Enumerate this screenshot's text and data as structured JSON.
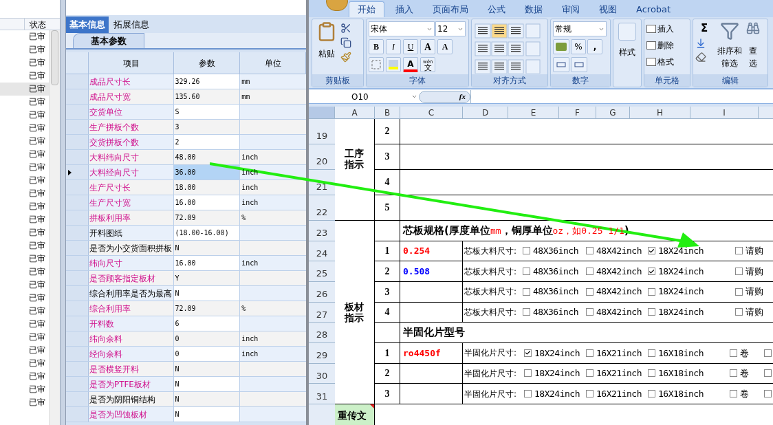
{
  "left_list": {
    "column_header": "状态",
    "rows": [
      {
        "status": "已审",
        "selected": false
      },
      {
        "status": "已审",
        "selected": false
      },
      {
        "status": "已审",
        "selected": false
      },
      {
        "status": "已审",
        "selected": false
      },
      {
        "status": "已审",
        "selected": true
      },
      {
        "status": "已审",
        "selected": false
      },
      {
        "status": "已审",
        "selected": false
      },
      {
        "status": "已审",
        "selected": false
      },
      {
        "status": "已审",
        "selected": false
      },
      {
        "status": "已审",
        "selected": false
      },
      {
        "status": "已审",
        "selected": false
      },
      {
        "status": "已审",
        "selected": false
      },
      {
        "status": "已审",
        "selected": false
      },
      {
        "status": "已审",
        "selected": false
      },
      {
        "status": "已审",
        "selected": false
      },
      {
        "status": "已审",
        "selected": false
      },
      {
        "status": "已审",
        "selected": false
      },
      {
        "status": "已审",
        "selected": false
      },
      {
        "status": "已审",
        "selected": false
      },
      {
        "status": "已审",
        "selected": false
      },
      {
        "status": "已审",
        "selected": false
      },
      {
        "status": "已审",
        "selected": false
      },
      {
        "status": "已审",
        "selected": false
      },
      {
        "status": "已审",
        "selected": false
      },
      {
        "status": "已审",
        "selected": false
      },
      {
        "status": "已审",
        "selected": false
      },
      {
        "status": "已审",
        "selected": false
      },
      {
        "status": "已审",
        "selected": false
      },
      {
        "status": "已审",
        "selected": false
      }
    ]
  },
  "detail_panel": {
    "tabs": [
      {
        "label": "基本信息",
        "selected": true
      },
      {
        "label": "拓展信息",
        "selected": false
      }
    ],
    "subtab": "基本参数",
    "columns": [
      "项目",
      "参数",
      "单位"
    ],
    "rows": [
      {
        "item": "成品尺寸长",
        "value": "329.26",
        "unit": "mm",
        "highlighted": true,
        "current": false
      },
      {
        "item": "成品尺寸宽",
        "value": "135.60",
        "unit": "mm",
        "highlighted": true,
        "current": false
      },
      {
        "item": "交货单位",
        "value": "S",
        "highlighted": true,
        "current": false
      },
      {
        "item": "生产拼板个数",
        "value": "3",
        "highlighted": true,
        "current": false
      },
      {
        "item": "交货拼板个数",
        "value": "2",
        "highlighted": true,
        "current": false
      },
      {
        "item": "大料纬向尺寸",
        "value": "48.00",
        "unit": "inch",
        "highlighted": true,
        "current": false
      },
      {
        "item": "大料经向尺寸",
        "value": "36.00",
        "unit": "inch",
        "highlighted": true,
        "current": true
      },
      {
        "item": "生产尺寸长",
        "value": "18.00",
        "unit": "inch",
        "highlighted": true,
        "current": false
      },
      {
        "item": "生产尺寸宽",
        "value": "16.00",
        "unit": "inch",
        "highlighted": true,
        "current": false
      },
      {
        "item": "拼板利用率",
        "value": "72.09",
        "unit": "%",
        "highlighted": true,
        "current": false
      },
      {
        "item": "开料图纸",
        "value": "(18.00-16.00)",
        "highlighted": false,
        "current": false
      },
      {
        "item": "是否为小交货面积拼板",
        "value": "N",
        "highlighted": false,
        "current": false
      },
      {
        "item": "纬向尺寸",
        "value": "16.00",
        "unit": "inch",
        "highlighted": true,
        "current": false
      },
      {
        "item": "是否顾客指定板材",
        "value": "Y",
        "highlighted": true,
        "current": false
      },
      {
        "item": "综合利用率是否为最高",
        "value": "N",
        "highlighted": false,
        "current": false
      },
      {
        "item": "综合利用率",
        "value": "72.09",
        "unit": "%",
        "highlighted": true,
        "current": false
      },
      {
        "item": "开料数",
        "value": "6",
        "highlighted": true,
        "current": false
      },
      {
        "item": "纬向余料",
        "value": "0",
        "unit": "inch",
        "highlighted": true,
        "current": false
      },
      {
        "item": "经向余料",
        "value": "0",
        "unit": "inch",
        "highlighted": true,
        "current": false
      },
      {
        "item": "是否横竖开料",
        "value": "N",
        "highlighted": true,
        "current": false
      },
      {
        "item": "是否为PTFE板材",
        "value": "N",
        "highlighted": true,
        "current": false
      },
      {
        "item": "是否为阴阳铜结构",
        "value": "N",
        "highlighted": false,
        "current": false
      },
      {
        "item": "是否为凹蚀板材",
        "value": "N",
        "highlighted": true,
        "current": false
      }
    ]
  },
  "excel": {
    "ribbon_tabs": [
      {
        "label": "开始",
        "selected": true
      },
      {
        "label": "插入",
        "selected": false
      },
      {
        "label": "页面布局",
        "selected": false
      },
      {
        "label": "公式",
        "selected": false
      },
      {
        "label": "数据",
        "selected": false
      },
      {
        "label": "审阅",
        "selected": false
      },
      {
        "label": "视图",
        "selected": false
      },
      {
        "label": "Acrobat",
        "selected": false
      }
    ],
    "clipboard": {
      "label": "剪贴板",
      "paste": "粘贴"
    },
    "font": {
      "label": "字体",
      "name": "宋体",
      "size": "12",
      "bold": "B",
      "italic": "I",
      "underline": "U",
      "grow": "A",
      "shrink": "A",
      "color_button": "A",
      "phonetic_top": "wén",
      "phonetic": "文"
    },
    "alignment": {
      "label": "对齐方式"
    },
    "number": {
      "label": "数字",
      "format": "常规",
      "percent": "%",
      "comma": ","
    },
    "styles": {
      "button": "样式"
    },
    "cells": {
      "label": "单元格",
      "items": [
        "插入",
        "删除",
        "格式"
      ]
    },
    "editing": {
      "label": "编辑",
      "sigma": "Σ",
      "sort_top": "排序和",
      "sort_bottom": "筛选",
      "find_top": "查",
      "find_bottom": "选"
    },
    "name_box": "O10",
    "fx": "fx",
    "columns": [
      "A",
      "B",
      "C",
      "D",
      "E",
      "F",
      "G",
      "H",
      "I"
    ],
    "row_headers": [
      "19",
      "20",
      "21",
      "22",
      "23",
      "24",
      "25",
      "26",
      "27",
      "28",
      "29",
      "30",
      "31"
    ],
    "process": {
      "label": "工序指示",
      "rows": [
        "2",
        "3",
        "4",
        "5"
      ]
    },
    "material": {
      "label": "板材指示",
      "core_title": [
        {
          "text": "芯板规格(厚度单位",
          "kind": "plain"
        },
        {
          "text": "mm",
          "kind": "emphasis"
        },
        {
          "text": "，铜厚单位",
          "kind": "plain"
        },
        {
          "text": "oz，如0.25 1/1",
          "kind": "emphasis"
        },
        {
          "text": ")",
          "kind": "plain"
        }
      ],
      "core_rows": [
        {
          "no": "1",
          "thickness": "0.254",
          "color": "#ff0000",
          "label": "芯板大料尺寸:",
          "options": [
            {
              "text": "48X36inch",
              "checked": false
            },
            {
              "text": "48X42inch",
              "checked": false
            },
            {
              "text": "18X24inch",
              "checked": true
            },
            {
              "text": "请购",
              "checked": false
            }
          ]
        },
        {
          "no": "2",
          "thickness": "0.508",
          "color": "#0000ff",
          "label": "芯板大料尺寸:",
          "options": [
            {
              "text": "48X36inch",
              "checked": false
            },
            {
              "text": "48X42inch",
              "checked": false
            },
            {
              "text": "18X24inch",
              "checked": true
            },
            {
              "text": "请购",
              "checked": false
            }
          ]
        },
        {
          "no": "3",
          "label": "芯板大料尺寸:",
          "options": [
            {
              "text": "48X36inch",
              "checked": false
            },
            {
              "text": "48X42inch",
              "checked": false
            },
            {
              "text": "18X24inch",
              "checked": false
            },
            {
              "text": "请购",
              "checked": false
            }
          ]
        },
        {
          "no": "4",
          "label": "芯板大料尺寸:",
          "options": [
            {
              "text": "48X36inch",
              "checked": false
            },
            {
              "text": "48X42inch",
              "checked": false
            },
            {
              "text": "18X24inch",
              "checked": false
            },
            {
              "text": "请购",
              "checked": false
            }
          ]
        }
      ],
      "prepreg_title": "半固化片型号",
      "prepreg_rows": [
        {
          "no": "1",
          "model": "ro4450f",
          "label": "半固化片尺寸:",
          "options": [
            {
              "text": "18X24inch",
              "checked": true
            },
            {
              "text": "16X21inch",
              "checked": false
            },
            {
              "text": "16X18inch",
              "checked": false
            },
            {
              "text": "卷",
              "checked": false
            },
            {
              "checked": false
            }
          ]
        },
        {
          "no": "2",
          "label": "半固化片尺寸:",
          "options": [
            {
              "text": "18X24inch",
              "checked": false
            },
            {
              "text": "16X21inch",
              "checked": false
            },
            {
              "text": "16X18inch",
              "checked": false
            },
            {
              "text": "卷",
              "checked": false
            },
            {
              "checked": false
            }
          ]
        },
        {
          "no": "3",
          "label": "半固化片尺寸:",
          "options": [
            {
              "text": "18X24inch",
              "checked": false
            },
            {
              "text": "16X21inch",
              "checked": false
            },
            {
              "text": "16X18inch",
              "checked": false
            },
            {
              "text": "卷",
              "checked": false
            },
            {
              "checked": false
            }
          ]
        }
      ]
    },
    "next_cell": "重传文"
  }
}
